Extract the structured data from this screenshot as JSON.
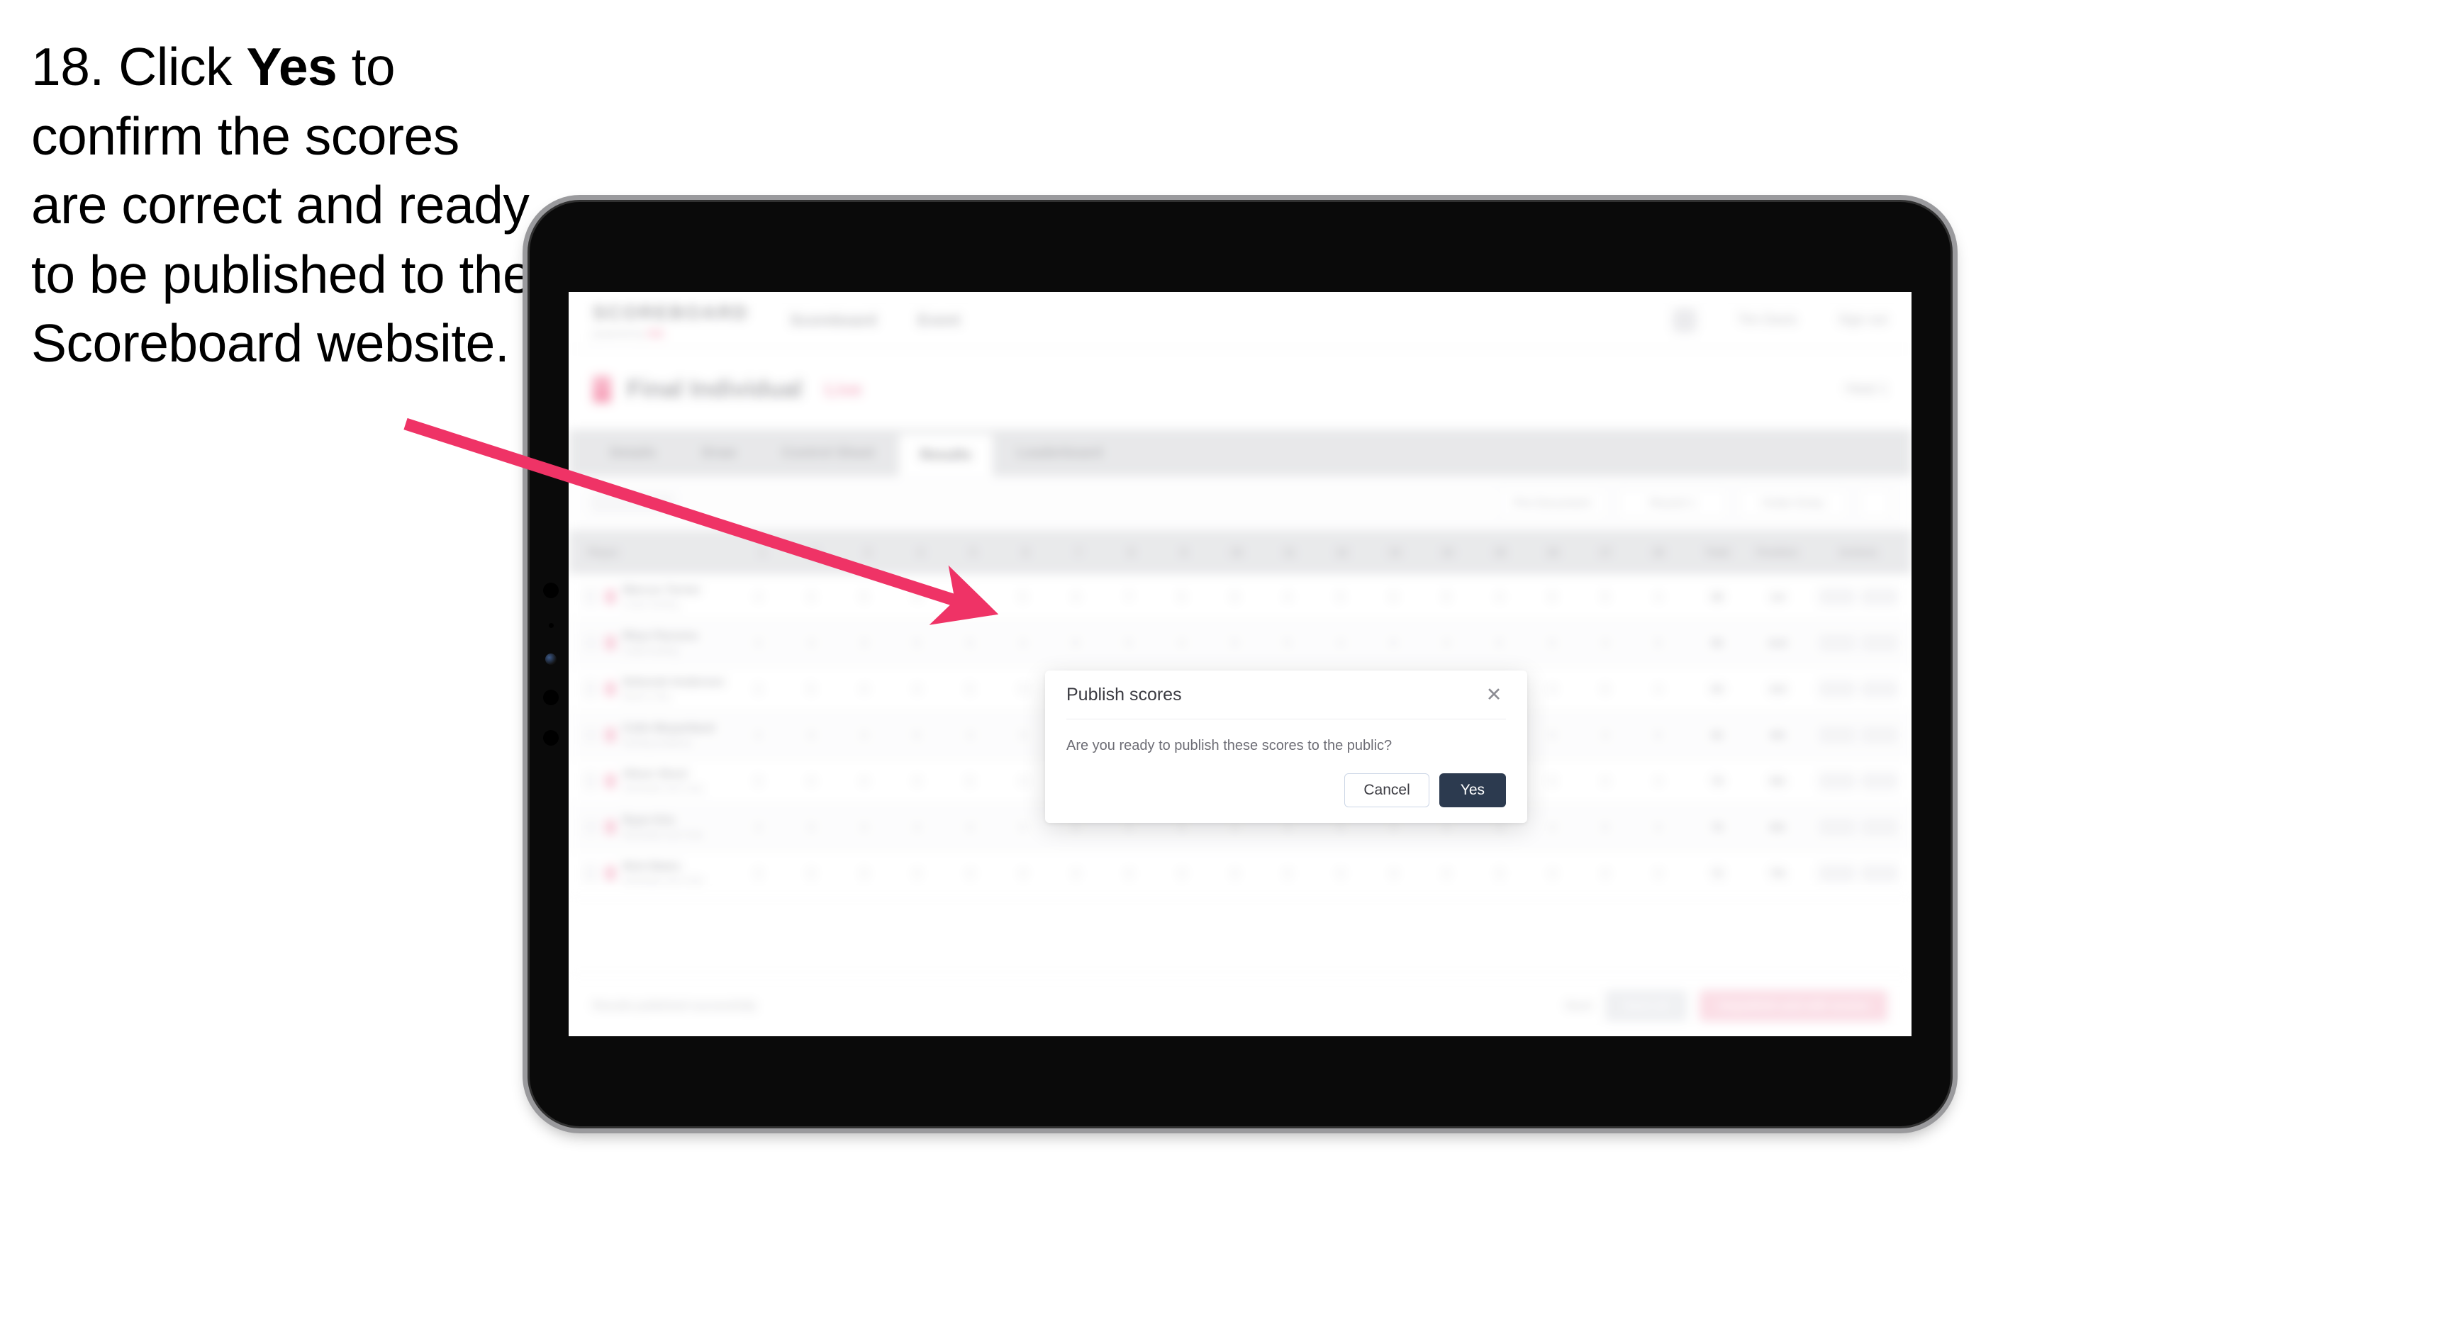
{
  "instruction": {
    "step_number": "18.",
    "text_before_bold": " Click ",
    "bold_word": "Yes",
    "text_after_bold": " to confirm the scores are correct and ready to be published to the Scoreboard website."
  },
  "colors": {
    "arrow": "#ef3366",
    "primary_button": "#2c3a4f",
    "brand_accent": "#ef4c79",
    "tab_strip_bg": "#d6d7da",
    "table_header_bg": "#d8d9dc",
    "device_body": "#0a0a0a",
    "device_bezel_edge": "#9a9a9d"
  },
  "device": {
    "type": "tablet",
    "sensors": [
      "camera-dot",
      "microphone-dot",
      "camera-lens",
      "speaker-dot",
      "speaker-dot"
    ]
  },
  "app": {
    "topbar": {
      "wordmark": "SCOREBOARD",
      "sub_label": "powered by",
      "sub_accent": "ISA",
      "nav_links": [
        "Scoreboard",
        "Event"
      ],
      "account_name": "Tim Davis",
      "sign_out": "Sign out"
    },
    "competition_header": {
      "title": "Final Individual",
      "badge": "Live",
      "right_meta": "Heat 1"
    },
    "tabs": [
      {
        "label": "Details",
        "active": false
      },
      {
        "label": "Draw",
        "active": false
      },
      {
        "label": "Control Sheet",
        "active": false
      },
      {
        "label": "Results",
        "active": true
      },
      {
        "label": "Leaderboard",
        "active": false
      }
    ],
    "filter_bar": {
      "search_placeholder": "Search",
      "pills": [
        "Pre Document",
        "Round 1"
      ],
      "sort_pill": "Order Entry"
    },
    "table": {
      "headers": {
        "player": "Player",
        "numbers": [
          "1",
          "2",
          "3",
          "4",
          "5",
          "6",
          "7",
          "8",
          "9",
          "10",
          "11",
          "12",
          "13",
          "14",
          "15",
          "16",
          "17",
          "18"
        ],
        "total": "Total",
        "position": "Position",
        "actions": "Actions"
      },
      "rows": [
        {
          "name": "Marcus Turner",
          "club": "Coast Surfing",
          "scores": [
            "4",
            "3",
            "5",
            "4",
            "6",
            "5",
            "4",
            "7",
            "5",
            "6",
            "4",
            "5",
            "6",
            "5",
            "4",
            "6",
            "5",
            "4"
          ],
          "total": "88",
          "position": "1st",
          "actions": [
            "Edit",
            "View"
          ]
        },
        {
          "name": "Rhys Parsons",
          "club": "Coast Surfing",
          "scores": [
            "4",
            "4",
            "3",
            "5",
            "5",
            "4",
            "6",
            "5",
            "4",
            "5",
            "5",
            "4",
            "6",
            "4",
            "5",
            "5",
            "4",
            "5"
          ],
          "total": "86",
          "position": "2nd",
          "actions": [
            "Edit",
            "View"
          ]
        },
        {
          "name": "Deborah Anderson",
          "club": "Beach Club",
          "scores": [
            "3",
            "5",
            "4",
            "4",
            "5",
            "6",
            "4",
            "5",
            "5",
            "4",
            "6",
            "5",
            "4",
            "5",
            "5",
            "4",
            "6",
            "4"
          ],
          "total": "84",
          "position": "3rd",
          "actions": [
            "Edit",
            "View"
          ]
        },
        {
          "name": "Colin Mcpartland",
          "club": "Surfing Academy",
          "scores": [
            "4",
            "3",
            "4",
            "5",
            "4",
            "5",
            "5",
            "6",
            "4",
            "5",
            "4",
            "5",
            "5",
            "4",
            "5",
            "5",
            "4",
            "5"
          ],
          "total": "82",
          "position": "4th",
          "actions": [
            "Edit",
            "View"
          ]
        },
        {
          "name": "Oliver Short",
          "club": "Northside Surf Club",
          "scores": [
            "3",
            "4",
            "4",
            "4",
            "5",
            "4",
            "5",
            "5",
            "4",
            "4",
            "5",
            "4",
            "5",
            "4",
            "4",
            "5",
            "4",
            "4"
          ],
          "total": "79",
          "position": "5th",
          "actions": [
            "Edit",
            "View"
          ]
        },
        {
          "name": "Ryan Kim",
          "club": "Northside Surf Club",
          "scores": [
            "3",
            "3",
            "4",
            "4",
            "4",
            "5",
            "4",
            "4",
            "5",
            "4",
            "4",
            "5",
            "4",
            "4",
            "4",
            "4",
            "5",
            "4"
          ],
          "total": "76",
          "position": "6th",
          "actions": [
            "Edit",
            "View"
          ]
        },
        {
          "name": "Nick Bates",
          "club": "Northside Surf Club",
          "scores": [
            "3",
            "3",
            "3",
            "4",
            "4",
            "4",
            "4",
            "4",
            "4",
            "4",
            "4",
            "4",
            "4",
            "4",
            "3",
            "4",
            "4",
            "4"
          ],
          "total": "72",
          "position": "7th",
          "actions": [
            "Edit",
            "View"
          ]
        }
      ]
    },
    "action_bar": {
      "note": "Results published successfully",
      "link": "Back",
      "secondary_button": "Save all",
      "danger_button": "Unpublish and edit scores"
    }
  },
  "modal": {
    "title": "Publish scores",
    "close_icon": "close-icon",
    "body": "Are you ready to publish these scores to the public?",
    "cancel_label": "Cancel",
    "confirm_label": "Yes"
  }
}
